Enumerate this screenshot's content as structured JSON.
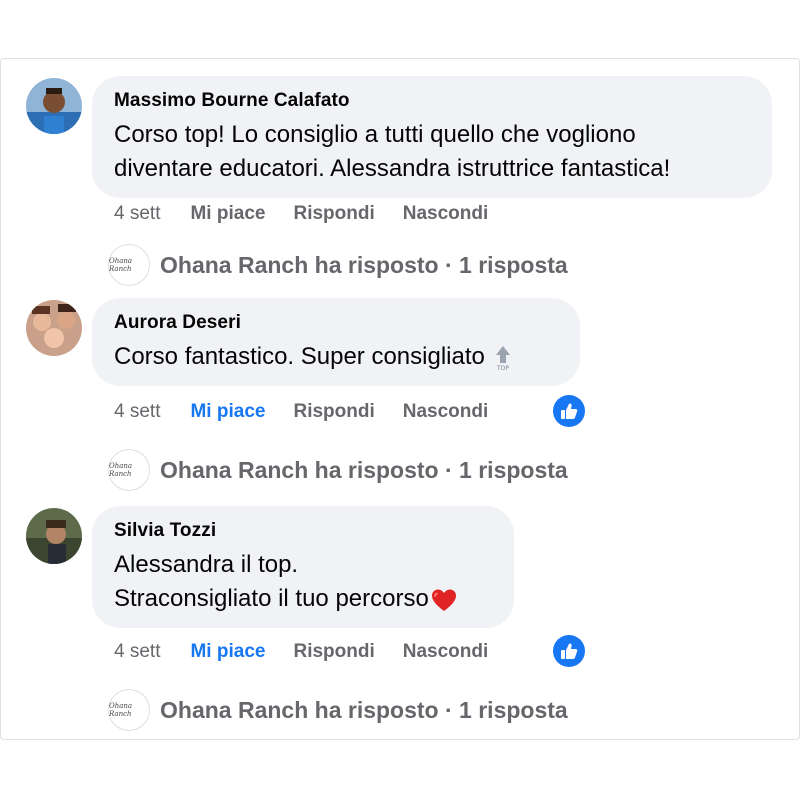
{
  "comments": [
    {
      "author": "Massimo Bourne Calafato",
      "lines": [
        "Corso top! Lo consiglio a tutti quello che vogliono",
        "diventare educatori. Alessandra istruttrice fantastica!"
      ],
      "time": "4 sett",
      "like_label": "Mi piace",
      "liked": false,
      "reply_label": "Rispondi",
      "hide_label": "Nascondi",
      "replies_summary": "Ohana Ranch ha risposto · 1 risposta"
    },
    {
      "author": "Aurora Deseri",
      "lines": [
        "Corso fantastico. Super consigliato"
      ],
      "time": "4 sett",
      "like_label": "Mi piace",
      "liked": true,
      "reply_label": "Rispondi",
      "hide_label": "Nascondi",
      "replies_summary": "Ohana Ranch ha risposto · 1 risposta"
    },
    {
      "author": "Silvia Tozzi",
      "lines": [
        "Alessandra il top.",
        "Straconsigliato il tuo percorso"
      ],
      "time": "4 sett",
      "like_label": "Mi piace",
      "liked": true,
      "reply_label": "Rispondi",
      "hide_label": "Nascondi",
      "replies_summary": "Ohana Ranch ha risposto · 1 risposta"
    }
  ],
  "page_logo_text": "Ohana Ranch",
  "top_icon_label": "TOP",
  "colors": {
    "accent": "#1877f2",
    "muted": "#65676b",
    "bubble": "#f0f2f5",
    "heart": "#e02424"
  },
  "icons": {
    "like_reaction": "thumbs-up-icon",
    "top": "top-arrow-icon",
    "heart": "heart-icon"
  }
}
